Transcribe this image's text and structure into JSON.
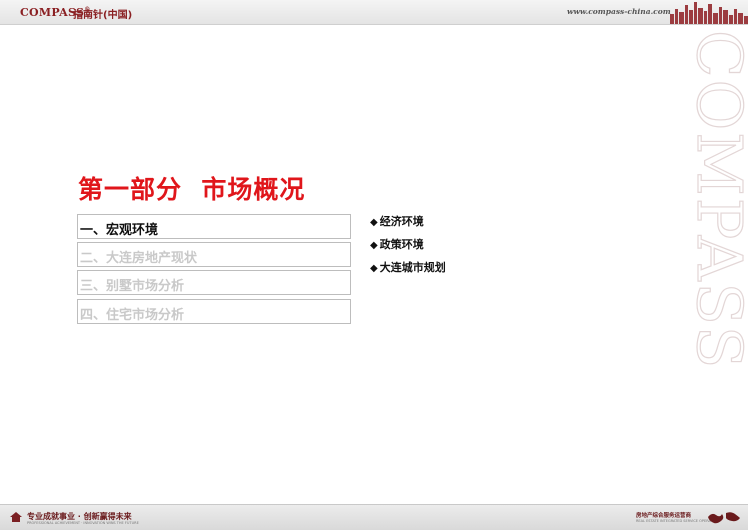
{
  "header": {
    "logo_compass": "COMPASS",
    "logo_registered": "®",
    "logo_cn": "指南针(中国)",
    "url": "www.compass-china.com"
  },
  "watermark_text": "COMPASS",
  "slide": {
    "title": "第一部分  市场概况",
    "menu": [
      {
        "label": "一、宏观环境",
        "active": true
      },
      {
        "label": "二、大连房地产现状",
        "active": false
      },
      {
        "label": "三、别墅市场分析",
        "active": false
      },
      {
        "label": "四、住宅市场分析",
        "active": false
      }
    ],
    "bullets": [
      "经济环境",
      "政策环境",
      "大连城市规划"
    ],
    "bullet_symbol": "◆"
  },
  "footer": {
    "slogan": "专业成就事业 · 创新赢得未来",
    "slogan_sub": "PROFESSIONAL ACHIEVEMENT · INNOVATION WINS THE FUTURE",
    "right_title": "房地产综合服务运营商",
    "right_sub": "REAL ESTATE INTEGRATED SERVICE OPERATOR"
  },
  "colors": {
    "brand_maroon": "#8a1f22",
    "title_red": "#e0161b",
    "inactive_gray": "#c9c9c9"
  }
}
